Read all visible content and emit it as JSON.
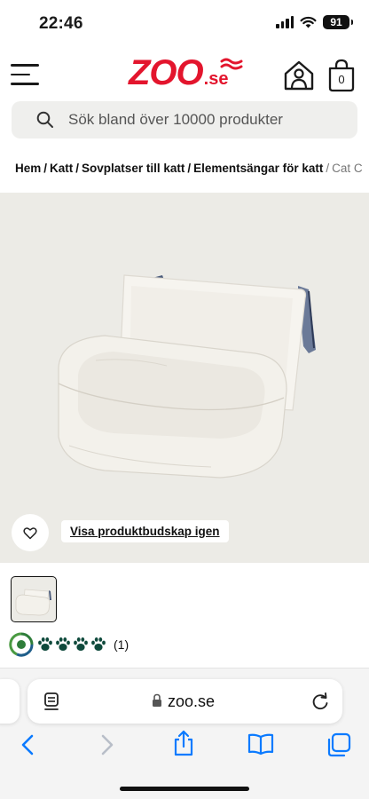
{
  "status": {
    "time": "22:46",
    "battery": "91"
  },
  "header": {
    "logo_text": "ZOO",
    "logo_suffix": ".se",
    "cart_count": "0"
  },
  "search": {
    "placeholder": "Sök bland över 10000 produkter"
  },
  "breadcrumb": {
    "items": [
      "Hem",
      "Katt",
      "Sovplatser till katt",
      "Elementsängar för katt"
    ],
    "current": "Cat C"
  },
  "product": {
    "visa_label": "Visa produktbudskap igen",
    "rating_count": "(1)",
    "rating_paws": 4
  },
  "browser": {
    "url": "zoo.se"
  },
  "colors": {
    "brand": "#e3152d",
    "paw": "#0f4a3c",
    "ios_blue": "#0a7aff"
  }
}
